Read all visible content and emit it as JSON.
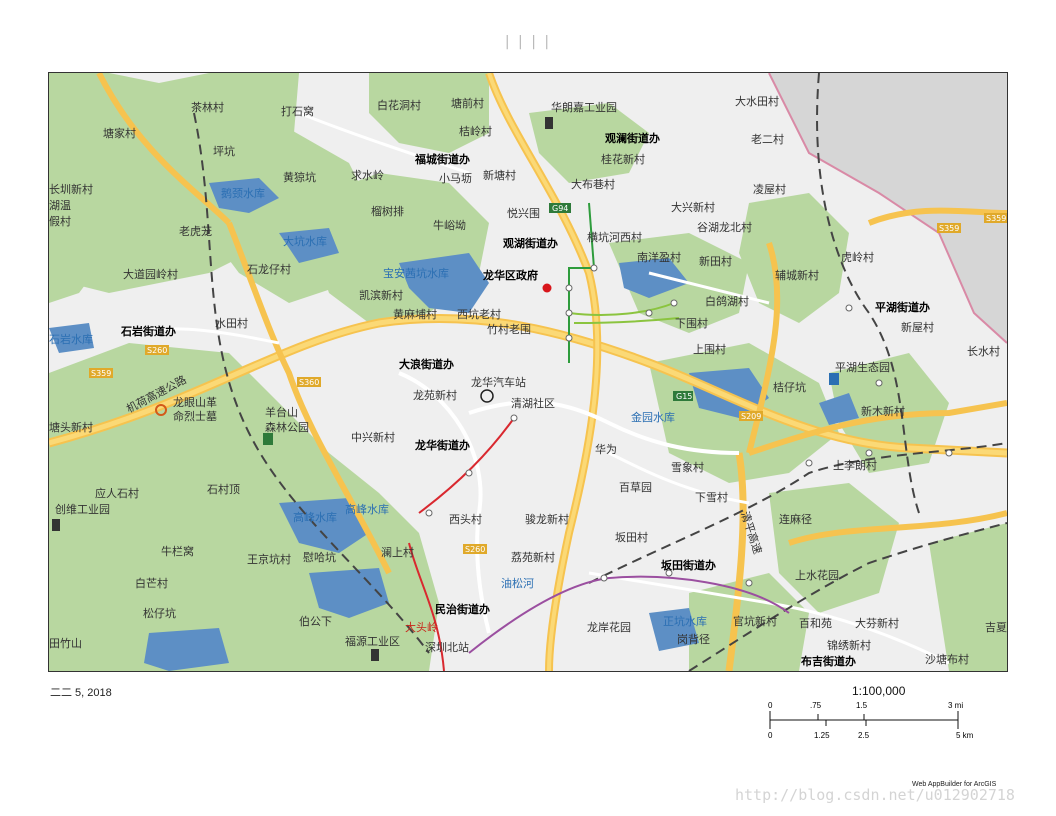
{
  "title": "| | | |",
  "footer": {
    "date": "二二 5, 2018",
    "scale": "1:100,000",
    "credit": "Web AppBuilder for ArcGIS",
    "watermark": "http://blog.csdn.net/u012902718"
  },
  "scalebar": {
    "mi_labels": [
      "0",
      ".75",
      "1.5",
      "3 mi"
    ],
    "km_labels": [
      "0",
      "1.25",
      "2.5",
      "5 km"
    ]
  },
  "map": {
    "places": [
      "茶林村",
      "打石窝",
      "白花洞村",
      "塘前村",
      "华朗嘉工业园",
      "大水田村",
      "塘家村",
      "桔岭村",
      "观澜街道办",
      "老二村",
      "坪坑",
      "福城街道办",
      "桂花新村",
      "黄猄坑",
      "求水岭",
      "小马坜",
      "新塘村",
      "大布巷村",
      "凌屋村",
      "长圳新村",
      "湖温",
      "假村",
      "榴树排",
      "悦兴围",
      "大兴新村",
      "老虎茏",
      "牛峪坳",
      "横坑河西村",
      "谷湖龙北村",
      "观湖街道办",
      "虎岭村",
      "石龙仔村",
      "南洋盈村",
      "新田村",
      "大道园岭村",
      "龙华区政府",
      "辅城新村",
      "凯滨新村",
      "白鸽湖村",
      "黄麻埔村",
      "西坑老村",
      "平湖街道办",
      "石岩街道办",
      "水田村",
      "竹村老围",
      "下围村",
      "新屋村",
      "上围村",
      "大浪街道办",
      "平湖生态园",
      "长水村",
      "龙华汽车站",
      "桔仔坑",
      "龙苑新村",
      "清湖社区",
      "新木新村",
      "羊台山",
      "森林公园",
      "中兴新村",
      "龙华街道办",
      "华为",
      "上李朗村",
      "塘头新村",
      "雪象村",
      "百草园",
      "应人石村",
      "石村顶",
      "西头村",
      "下雪村",
      "创维工业园",
      "骏龙新村",
      "连麻径",
      "牛栏窝",
      "坂田村",
      "王京坑村",
      "慰哈坑",
      "澜上村",
      "荔苑新村",
      "坂田街道办",
      "白芒村",
      "上水花园",
      "松仔坑",
      "民治街道办",
      "伯公下",
      "龙岸花园",
      "官坑新村",
      "百和苑",
      "大芬新村",
      "吉夏",
      "福源工业区",
      "岗背径",
      "锦绣新村",
      "田竹山",
      "深圳北站",
      "布吉街道办",
      "沙塘布村"
    ],
    "red_labels": [
      "大头岭"
    ],
    "water": [
      "鹅颈水库",
      "大坑水库",
      "宝安茜坑水库",
      "石岩水库",
      "金园水库",
      "高峰水库",
      "高峰水库",
      "油松河",
      "正坑水库"
    ],
    "memorial": [
      "龙眼山革",
      "命烈士墓"
    ],
    "highway_name": "机荷高速公路",
    "highway_name2": "清平高速",
    "shields": [
      "S359",
      "S359",
      "G94",
      "S260",
      "S359",
      "S360",
      "G15",
      "S209",
      "S260"
    ]
  }
}
